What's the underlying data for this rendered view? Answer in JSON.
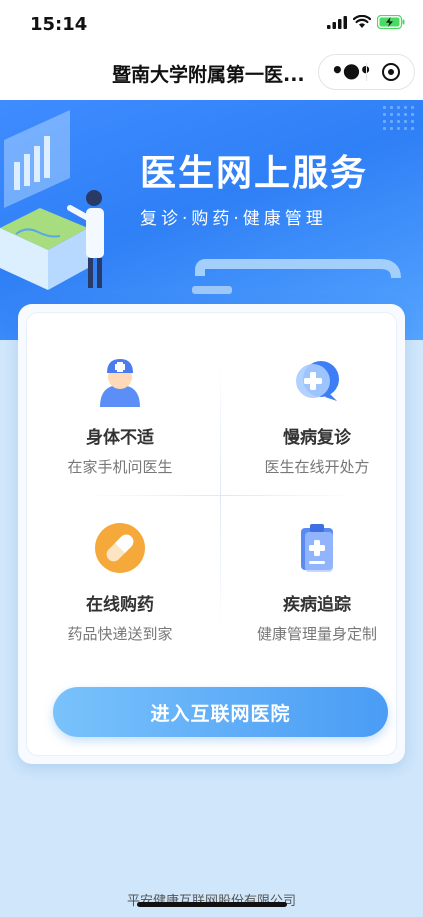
{
  "status_bar": {
    "time": "15:14"
  },
  "nav": {
    "title": "暨南大学附属第一医..."
  },
  "banner": {
    "title": "医生网上服务",
    "subtitle": "复诊·购药·健康管理"
  },
  "services": [
    {
      "title": "身体不适",
      "subtitle": "在家手机问医生",
      "icon": "doctor-nurse-icon"
    },
    {
      "title": "慢病复诊",
      "subtitle": "医生在线开处方",
      "icon": "chat-plus-icon"
    },
    {
      "title": "在线购药",
      "subtitle": "药品快递送到家",
      "icon": "pill-icon"
    },
    {
      "title": "疾病追踪",
      "subtitle": "健康管理量身定制",
      "icon": "clipboard-plus-icon"
    }
  ],
  "enter_button": {
    "label": "进入互联网医院"
  },
  "footer": {
    "text": "平安健康互联网股份有限公司"
  },
  "colors": {
    "brand_blue": "#2f7ff6",
    "button_start": "#79c2fb",
    "button_end": "#4a9cf5",
    "battery": "#4cd964"
  }
}
